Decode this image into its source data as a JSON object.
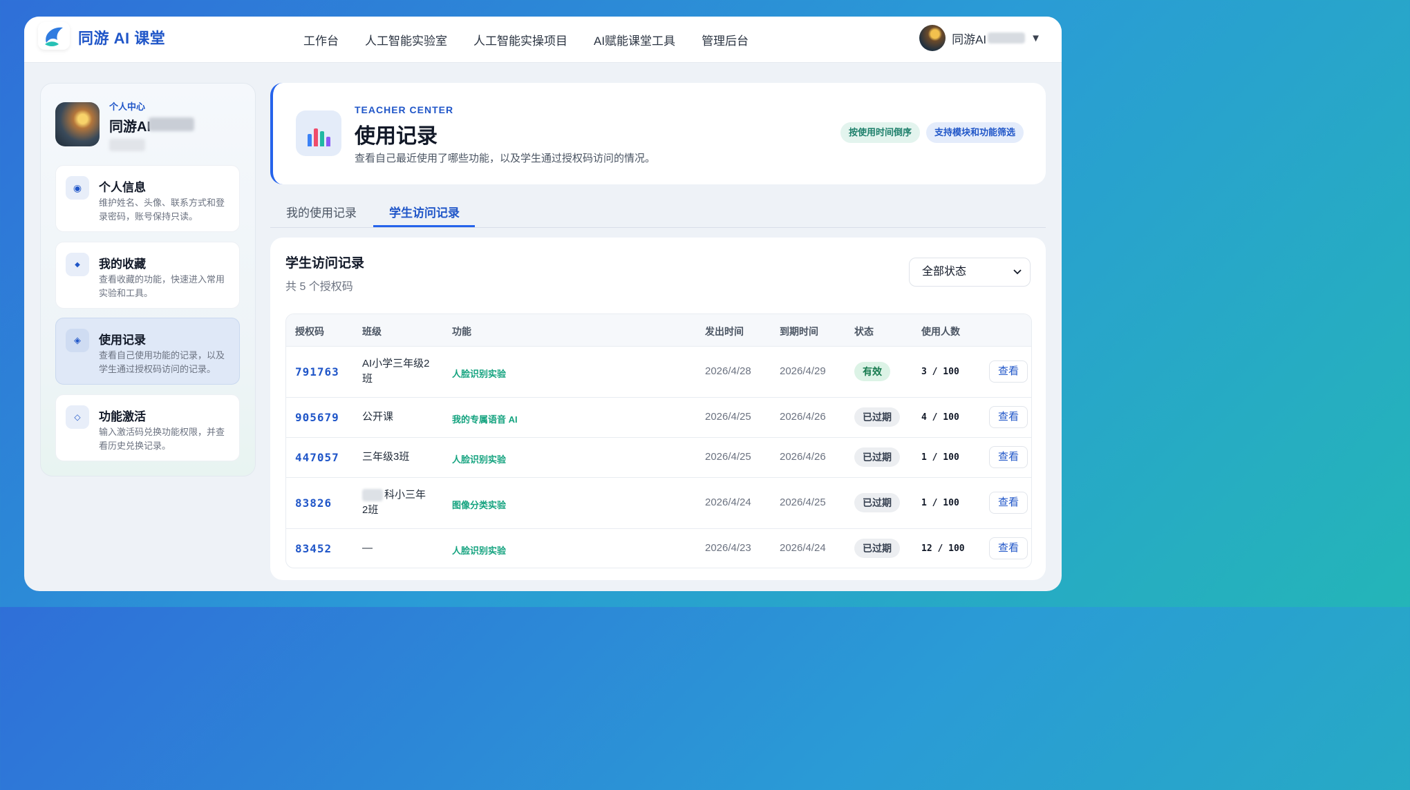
{
  "app": {
    "brand": "同游 AI 课堂"
  },
  "nav": {
    "items": [
      "工作台",
      "人工智能实验室",
      "人工智能实操项目",
      "AI赋能课堂工具",
      "管理后台"
    ]
  },
  "user": {
    "name": "同游AI",
    "caret": "▼"
  },
  "sidebar": {
    "tag": "个人中心",
    "name": "同游AI",
    "items": [
      {
        "title": "个人信息",
        "desc": "维护姓名、头像、联系方式和登录密码，账号保持只读。",
        "icon": "radio-icon",
        "glyph": "◉"
      },
      {
        "title": "我的收藏",
        "desc": "查看收藏的功能，快速进入常用实验和工具。",
        "icon": "diamond-icon",
        "glyph": "◆"
      },
      {
        "title": "使用记录",
        "desc": "查看自己使用功能的记录，以及学生通过授权码访问的记录。",
        "icon": "diamond-dot-icon",
        "glyph": "◈"
      },
      {
        "title": "功能激活",
        "desc": "输入激活码兑换功能权限，并查看历史兑换记录。",
        "icon": "diamond-outline-icon",
        "glyph": "◇"
      }
    ]
  },
  "header": {
    "kicker": "TEACHER CENTER",
    "title": "使用记录",
    "subtitle": "查看自己最近使用了哪些功能，以及学生通过授权码访问的情况。",
    "chips": [
      "按使用时间倒序",
      "支持模块和功能筛选"
    ]
  },
  "tabs": [
    "我的使用记录",
    "学生访问记录"
  ],
  "table_card": {
    "title": "学生访问记录",
    "count": "共 5 个授权码",
    "filter": "全部状态",
    "columns": [
      "授权码",
      "班级",
      "功能",
      "发出时间",
      "到期时间",
      "状态",
      "使用人数"
    ],
    "rows": [
      {
        "code": "791763",
        "cls": "AI小学三年级2班",
        "func": "人脸识别实验",
        "issued": "2026/4/28",
        "expires": "2026/4/29",
        "status": "有效",
        "usage": "3 / 100",
        "action": "查看"
      },
      {
        "code": "905679",
        "cls": "公开课",
        "func": "我的专属语音 AI",
        "issued": "2026/4/25",
        "expires": "2026/4/26",
        "status": "已过期",
        "usage": "4 / 100",
        "action": "查看"
      },
      {
        "code": "447057",
        "cls": "三年级3班",
        "func": "人脸识别实验",
        "issued": "2026/4/25",
        "expires": "2026/4/26",
        "status": "已过期",
        "usage": "1 / 100",
        "action": "查看"
      },
      {
        "code": "83826",
        "cls": "科小三年2班",
        "func": "图像分类实验",
        "issued": "2026/4/24",
        "expires": "2026/4/25",
        "status": "已过期",
        "usage": "1 / 100",
        "action": "查看"
      },
      {
        "code": "83452",
        "cls": "—",
        "func": "人脸识别实验",
        "issued": "2026/4/23",
        "expires": "2026/4/24",
        "status": "已过期",
        "usage": "12 / 100",
        "action": "查看"
      }
    ]
  },
  "colors": {
    "accent": "#2056c8",
    "func_green": "#14a37f",
    "valid_bg": "#dcf3e6"
  }
}
